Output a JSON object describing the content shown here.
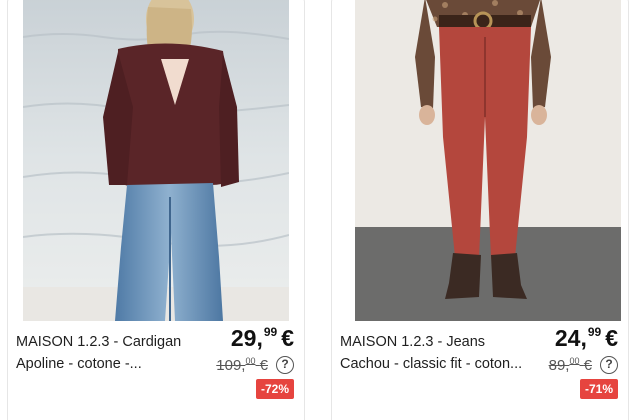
{
  "products": [
    {
      "title_line1": "MAISON 1.2.3 - Cardigan",
      "title_line2": "Apoline - cotone -...",
      "price_main": "29,",
      "price_cents": "99",
      "currency": "€",
      "old_price_main": "109,",
      "old_price_cents": "00",
      "old_currency": "€",
      "help": "?",
      "discount": "-72%",
      "image_icon": "cardigan-photo"
    },
    {
      "title_line1": "MAISON 1.2.3 - Jeans",
      "title_line2": "Cachou - classic fit - coton...",
      "price_main": "24,",
      "price_cents": "99",
      "currency": "€",
      "old_price_main": "89,",
      "old_price_cents": "00",
      "old_currency": "€",
      "help": "?",
      "discount": "-71%",
      "image_icon": "jeans-photo"
    }
  ],
  "colors": {
    "discount_badge": "#e6443f",
    "card_border": "#e6e6e6"
  }
}
